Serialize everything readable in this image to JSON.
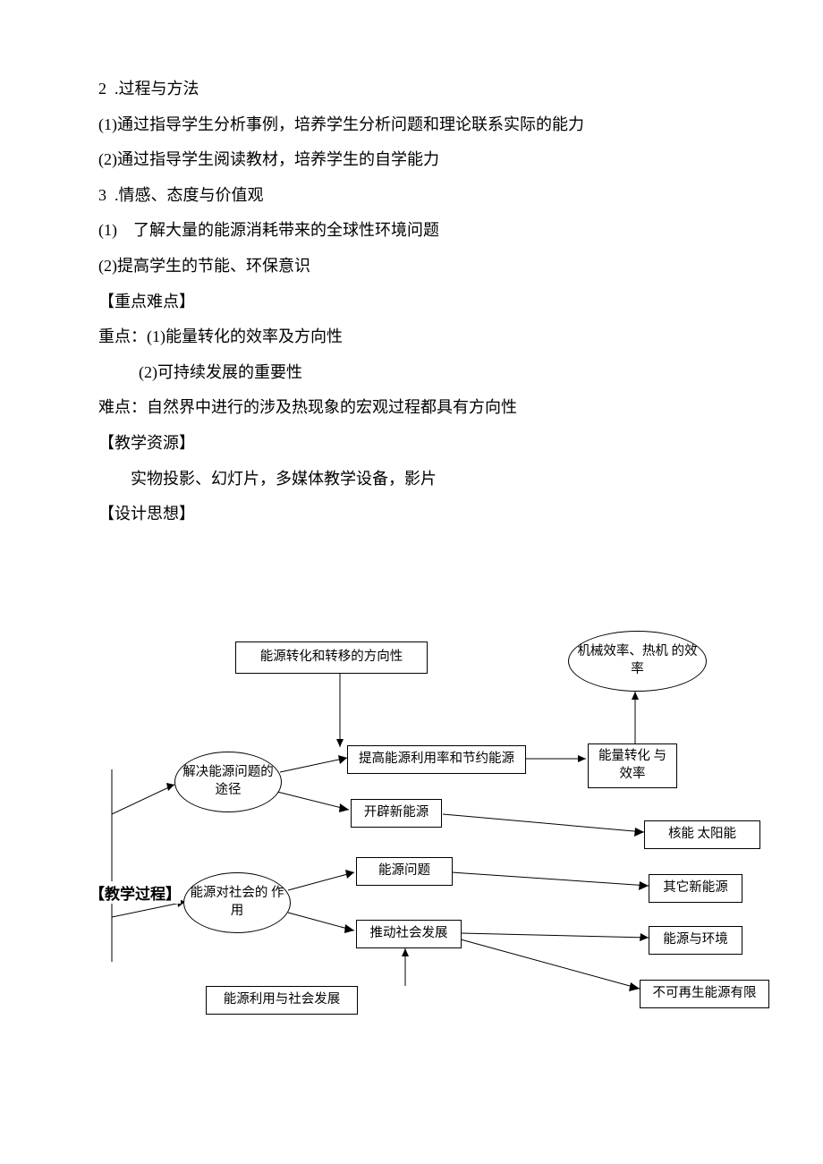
{
  "text": {
    "l1": "2  .过程与方法",
    "l2": "(1)通过指导学生分析事例，培养学生分析问题和理论联系实际的能力",
    "l3": "(2)通过指导学生阅读教材，培养学生的自学能力",
    "l4": "3  .情感、态度与价值观",
    "l5": "(1)    了解大量的能源消耗带来的全球性环境问题",
    "l6": "(2)提高学生的节能、环保意识",
    "l7": "【重点难点】",
    "l8": "重点：(1)能量转化的效率及方向性",
    "l9": "          (2)可持续发展的重要性",
    "l10": "难点：自然界中进行的涉及热现象的宏观过程都具有方向性",
    "l11": "【教学资源】",
    "l12": "        实物投影、幻灯片，多媒体教学设备，影片",
    "l13": "【设计思想】",
    "teachProcess": "【教学过程】"
  },
  "diagram": {
    "nodes": {
      "dirConversion": "能源转化和转移的方向性",
      "solvePath": "解决能源问题的途径",
      "energyRole": "能源对社会的\n作用",
      "utilDev": "能源利用与社会发展",
      "improve": "提高能源利用率和节约能源",
      "newSrc": "开辟新能源",
      "problem": "能源问题",
      "drive": "推动社会发展",
      "mechEff": "机械效率、热机\n的效率",
      "convEff": "能量转化\n与效率",
      "nuclear": "核能     太阳能",
      "otherNew": "其它新能源",
      "env": "能源与环境",
      "nonRenew": "不可再生能源有限"
    }
  }
}
